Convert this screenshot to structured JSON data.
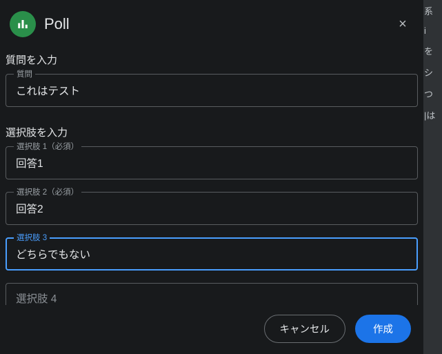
{
  "dialog": {
    "title": "Poll",
    "close_icon": "×",
    "question_section_label": "質問を入力",
    "question_field_label": "質問",
    "question_value": "これはテスト",
    "options_section_label": "選択肢を入力",
    "options": [
      {
        "label": "選択肢 1（必須）",
        "value": "回答1",
        "focused": false
      },
      {
        "label": "選択肢 2（必須）",
        "value": "回答2",
        "focused": false
      },
      {
        "label": "選択肢 3",
        "value": "どちらでもない",
        "focused": true
      },
      {
        "label": "",
        "value": "",
        "placeholder": "選択肢 4",
        "focused": false
      }
    ],
    "cancel_label": "キャンセル",
    "create_label": "作成"
  },
  "colors": {
    "accent": "#4a9fff",
    "poll_icon_bg": "#2a8f4a",
    "primary_button": "#1c74e8"
  }
}
